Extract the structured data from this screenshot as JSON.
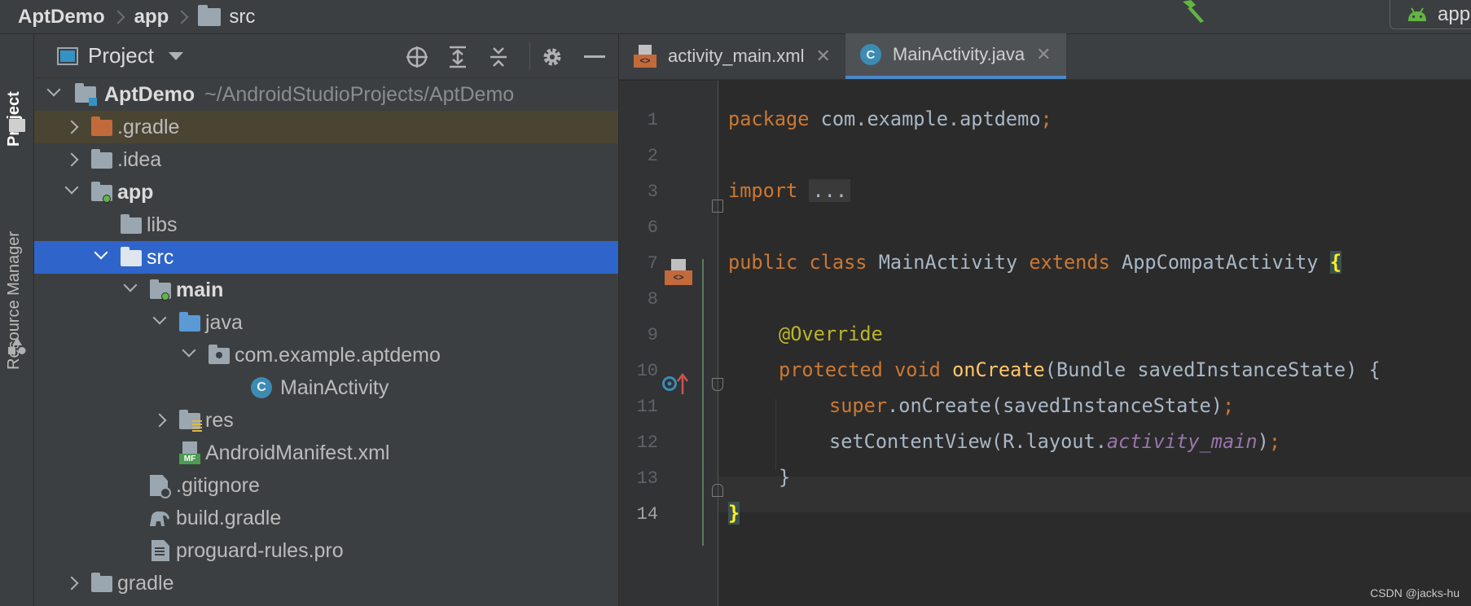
{
  "breadcrumb": {
    "items": [
      "AptDemo",
      "app",
      "src"
    ]
  },
  "run_config": {
    "label": "app"
  },
  "tool_strip": {
    "project_tab": "Project",
    "resource_tab": "Resource Manager"
  },
  "project_panel": {
    "title": "Project",
    "root": {
      "name": "AptDemo",
      "path": "~/AndroidStudioProjects/AptDemo"
    },
    "rows": [
      ".gradle",
      ".idea",
      "app",
      "libs",
      "src",
      "main",
      "java",
      "com.example.aptdemo",
      "MainActivity",
      "res",
      "AndroidManifest.xml",
      ".gitignore",
      "build.gradle",
      "proguard-rules.pro",
      "gradle"
    ],
    "icons": {
      "class_letter": "C",
      "manifest_badge": "MF"
    }
  },
  "editor": {
    "tabs": [
      {
        "label": "activity_main.xml",
        "icon_text": "<>"
      },
      {
        "label": "MainActivity.java",
        "icon_text": "C"
      }
    ],
    "close_glyph": "✕",
    "line_numbers": [
      "1",
      "2",
      "3",
      "6",
      "7",
      "8",
      "9",
      "10",
      "11",
      "12",
      "13",
      "14"
    ],
    "code": {
      "l1_kw": "package",
      "l1_rest": " com.example.aptdemo",
      "l1_semi": ";",
      "l3_kw": "import",
      "l3_fold": "...",
      "l7_kw1": "public",
      "l7_kw2": "class",
      "l7_name": " MainActivity ",
      "l7_kw3": "extends",
      "l7_super": " AppCompatActivity ",
      "l7_brace": "{",
      "l9_ann": "@Override",
      "l10_kw1": "protected",
      "l10_kw2": "void",
      "l10_method": "onCreate",
      "l10_rest": "(Bundle savedInstanceState) {",
      "l11_kw": "super",
      "l11_rest": ".onCreate(savedInstanceState)",
      "l11_semi": ";",
      "l12_pre": "setContentView(R.layout.",
      "l12_field": "activity_main",
      "l12_post": ")",
      "l12_semi": ";",
      "l13": "}",
      "l14_brace": "}"
    }
  },
  "watermark": "CSDN @jacks-hu",
  "colors": {
    "selection": "#2f65ca",
    "keyword": "#cc7832",
    "annotation": "#bbb529",
    "method": "#ffc66d",
    "field": "#9876aa"
  }
}
